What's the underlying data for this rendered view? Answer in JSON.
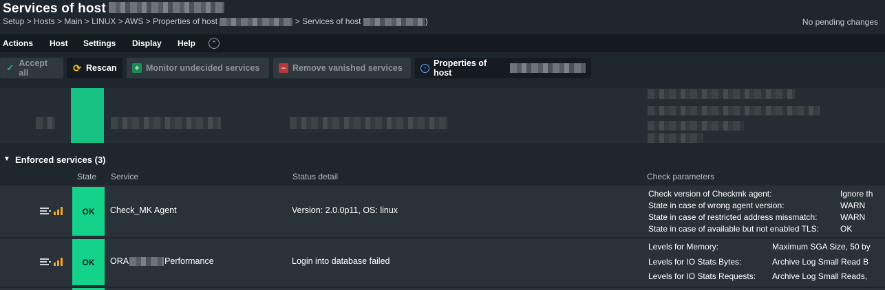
{
  "header": {
    "title": "Services of host",
    "breadcrumb": {
      "part1": "Setup > Hosts > Main > LINUX > AWS > Properties of host",
      "part2": "> Services of host",
      "part3": ")"
    },
    "pending": "No pending changes"
  },
  "menu": {
    "items": [
      "Actions",
      "Host",
      "Settings",
      "Display",
      "Help"
    ]
  },
  "toolbar": {
    "accept_all": "Accept all",
    "rescan": "Rescan",
    "monitor_undecided": "Monitor undecided services",
    "remove_vanished": "Remove vanished services",
    "properties_of_host": "Properties of host"
  },
  "colors": {
    "ok_state": "#15d28a",
    "background": "#1e262e",
    "row": "#2a3239"
  },
  "section": {
    "title": "Enforced services (3)"
  },
  "table": {
    "headers": {
      "state": "State",
      "service": "Service",
      "status_detail": "Status detail",
      "check_parameters": "Check parameters"
    },
    "rows": [
      {
        "state": "OK",
        "service": "Check_MK Agent",
        "detail": "Version: 2.0.0p11, OS: linux",
        "params": [
          {
            "key": "Check version of Checkmk agent:",
            "value": "Ignore th"
          },
          {
            "key": "State in case of wrong agent version:",
            "value": "WARN"
          },
          {
            "key": "State in case of restricted address missmatch:",
            "value": "WARN"
          },
          {
            "key": "State in case of available but not enabled TLS:",
            "value": "OK"
          }
        ]
      },
      {
        "state": "OK",
        "service_prefix": "ORA",
        "service_suffix": "Performance",
        "detail": "Login into database failed",
        "params": [
          {
            "key": "Levels for Memory:",
            "value": "Maximum SGA Size, 50 by"
          },
          {
            "key": "Levels for IO Stats Bytes:",
            "value": "Archive Log Small Read B"
          },
          {
            "key": "Levels for IO Stats Requests:",
            "value": "Archive Log Small Reads,"
          }
        ]
      }
    ]
  }
}
